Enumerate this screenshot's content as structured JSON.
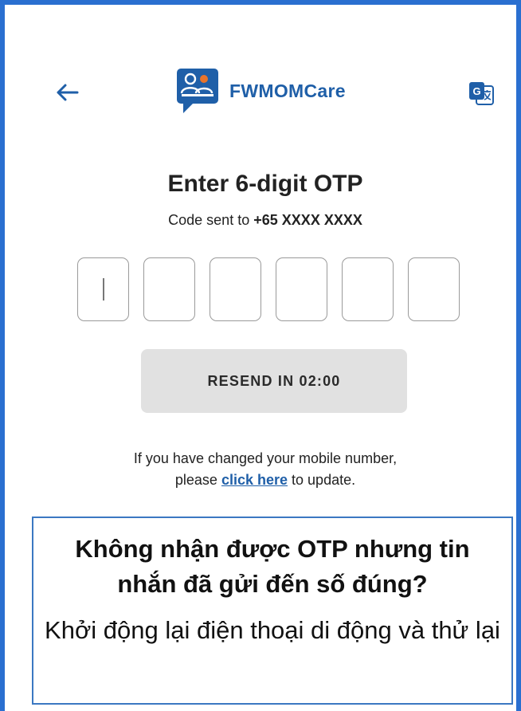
{
  "header": {
    "back_icon": "arrow-left-icon",
    "app_name": "FWMOMCare",
    "logo_icon": "fwmomcare-logo-icon",
    "translate_icon": "google-translate-icon"
  },
  "otp": {
    "title": "Enter 6-digit OTP",
    "sent_prefix": "Code sent to",
    "country_code": "+65",
    "masked_number": "XXXX XXXX",
    "digit_count": 6,
    "values": [
      "",
      "",
      "",
      "",
      "",
      ""
    ]
  },
  "resend": {
    "label": "RESEND IN 02:00"
  },
  "change_number": {
    "line1": "If you have changed your mobile number,",
    "line2_prefix": "please",
    "link_text": "click here",
    "line2_suffix": "to update."
  },
  "tip": {
    "title": "Không nhận được OTP nhưng tin nhắn đã gửi đến số đúng?",
    "body": "Khởi động lại điện thoại di động và thử lại"
  },
  "colors": {
    "brand_blue": "#1f5fa8",
    "frame_blue": "#2a6fd0",
    "resend_bg": "#e1e1e1"
  }
}
